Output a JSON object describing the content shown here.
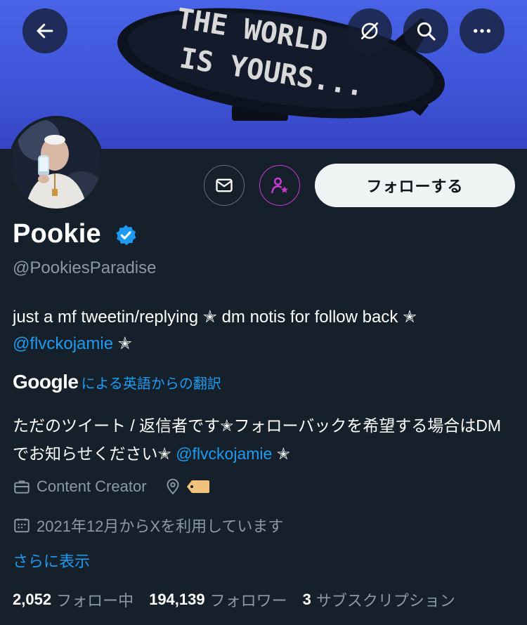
{
  "banner": {
    "text_line1": "THE WORLD",
    "text_line2": "IS  YOURS..."
  },
  "toolbar": {
    "back_icon": "back-arrow-icon",
    "no_signal_icon": "slashed-circle-icon",
    "search_icon": "search-icon",
    "more_icon": "more-dots-icon"
  },
  "actions": {
    "message_icon": "mail-icon",
    "subscribe_icon": "person-star-icon",
    "follow_label": "フォローする"
  },
  "profile": {
    "name": "Pookie",
    "handle": "@PookiesParadise",
    "verified_color": "#1d9bf0",
    "bio_part1": "just a mf tweetin/replying ✭ dm notis for follow back ✭",
    "bio_mention": "@flvckojamie",
    "bio_part2": "✭"
  },
  "translation": {
    "brand": "Google",
    "label": "による英語からの翻訳",
    "text_part1": "ただのツイート / 返信者です✭フォローバックを希望する場合はDMでお知らせください✭",
    "mention": "@flvckojamie",
    "text_part2": "✭"
  },
  "meta": {
    "category": "Content Creator",
    "joined": "2021年12月からXを利用しています",
    "show_more": "さらに表示"
  },
  "stats": {
    "following_count": "2,052",
    "following_label": "フォロー中",
    "followers_count": "194,139",
    "followers_label": "フォロワー",
    "subscriptions_count": "3",
    "subscriptions_label": "サブスクリプション"
  },
  "colors": {
    "background": "#15202b",
    "accent": "#1d9bf0",
    "subscribe": "#c63ad1",
    "secondary_text": "#8b98a5"
  }
}
